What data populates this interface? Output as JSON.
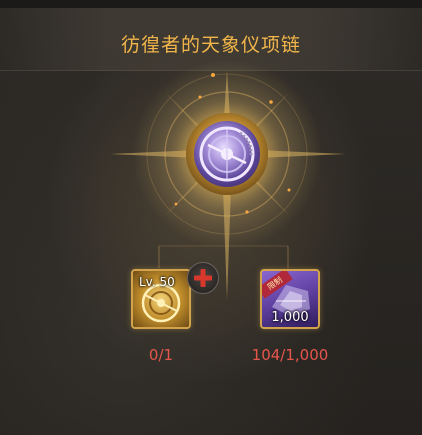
{
  "title": "彷徨者的天象仪项链",
  "main_item": {
    "icon": "astrolabe-necklace-icon"
  },
  "materials": [
    {
      "icon": "golden-astrolabe-icon",
      "level_label": "Lv. 50",
      "count_text": "0/1"
    },
    {
      "icon": "purple-material-icon",
      "ribbon_text": "限制",
      "quantity_label": "1,000",
      "count_text": "104/1,000"
    }
  ],
  "add_button": {
    "icon": "plus-icon"
  },
  "colors": {
    "title": "#f2b64a",
    "count": "#e6564c",
    "accent_gold": "#d2a34a",
    "add_plus": "#d8382c"
  }
}
